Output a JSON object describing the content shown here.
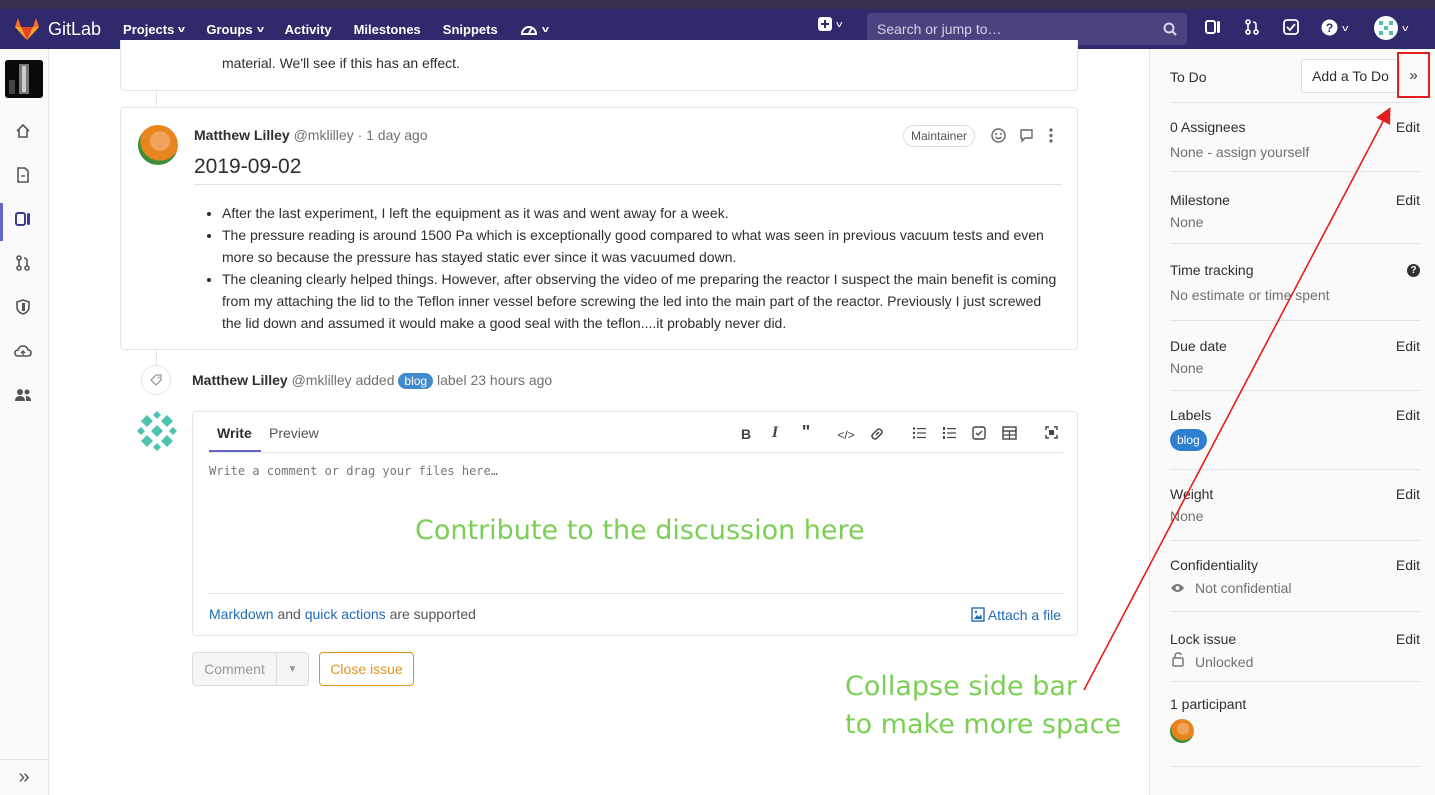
{
  "navbar": {
    "brand": "GitLab",
    "items": [
      {
        "label": "Projects",
        "dropdown": true
      },
      {
        "label": "Groups",
        "dropdown": true
      },
      {
        "label": "Activity",
        "dropdown": false
      },
      {
        "label": "Milestones",
        "dropdown": false
      },
      {
        "label": "Snippets",
        "dropdown": false
      }
    ],
    "search_placeholder": "Search or jump to…",
    "icons": [
      "dashboard-icon",
      "plus-icon",
      "search-icon",
      "issues-icon",
      "merge-request-icon",
      "todo-icon",
      "help-icon",
      "user-avatar"
    ]
  },
  "left_sidebar": {
    "icons": [
      "project-avatar",
      "home-icon",
      "repository-icon",
      "issues-icon",
      "merge-requests-icon",
      "security-icon",
      "operations-icon",
      "members-icon"
    ],
    "collapse_label": "»"
  },
  "previous_note": {
    "text": "material. We'll see if this has an effect."
  },
  "note": {
    "author": "Matthew Lilley",
    "username": "@mklilley",
    "time": "· 1 day ago",
    "role": "Maintainer",
    "title": "2019-09-02",
    "bullets": [
      "After the last experiment, I left the equipment as it was and went away for a week.",
      "The pressure reading is around 1500 Pa which is exceptionally good compared to what was seen in previous vacuum tests and even more so because the pressure has stayed static ever since it was vacuumed down.",
      "The cleaning clearly helped things. However, after observing the video of me preparing the reactor I suspect the main benefit is coming from my attaching the lid to the Teflon inner vessel before screwing the led into the main part of the reactor. Previously I just screwed the lid down and assumed it would make a good seal with the teflon....it probably never did."
    ]
  },
  "system_note": {
    "author": "Matthew Lilley",
    "username": "@mklilley",
    "action": "added",
    "label": "blog",
    "suffix": "label 23 hours ago"
  },
  "editor": {
    "tab_write": "Write",
    "tab_preview": "Preview",
    "placeholder": "Write a comment or drag your files here…",
    "footer_markdown": "Markdown",
    "footer_and": "and",
    "footer_quick": "quick actions",
    "footer_supported": "are supported",
    "attach": "Attach a file",
    "toolbar": [
      "bold-icon",
      "italic-icon",
      "quote-icon",
      "code-icon",
      "link-icon",
      "bullet-list-icon",
      "numbered-list-icon",
      "task-list-icon",
      "table-icon",
      "fullscreen-icon"
    ]
  },
  "actions": {
    "comment": "Comment",
    "close_issue": "Close issue"
  },
  "annotations": {
    "discussion": "Contribute to the discussion here",
    "collapse_line1": "Collapse side bar",
    "collapse_line2": "to make more space",
    "color": "#7ccf55",
    "arrow_color": "#e41e1e"
  },
  "right_sidebar": {
    "todo_label": "To Do",
    "todo_button": "Add a To Do",
    "collapse_button": "»",
    "assignees_title": "0 Assignees",
    "assignees_value": "None - assign yourself",
    "milestone_title": "Milestone",
    "milestone_value": "None",
    "time_title": "Time tracking",
    "time_value": "No estimate or time spent",
    "due_title": "Due date",
    "due_value": "None",
    "labels_title": "Labels",
    "labels_value": "blog",
    "weight_title": "Weight",
    "weight_value": "None",
    "conf_title": "Confidentiality",
    "conf_value": "Not confidential",
    "lock_title": "Lock issue",
    "lock_value": "Unlocked",
    "participants_title": "1 participant",
    "edit_label": "Edit"
  }
}
